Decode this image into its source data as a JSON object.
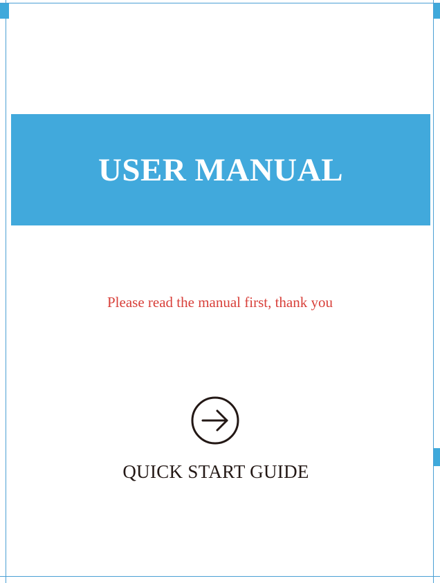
{
  "cover": {
    "title": "USER MANUAL",
    "notice": "Please read the manual first, thank you",
    "guide_label": "QUICK START GUIDE",
    "guide_icon": "arrow-right-circle-icon"
  },
  "colors": {
    "banner": "#41a9dc",
    "title_text": "#ffffff",
    "notice_text": "#d8403a",
    "guide_text": "#231815",
    "crop_marks": "#4a9fd4"
  }
}
